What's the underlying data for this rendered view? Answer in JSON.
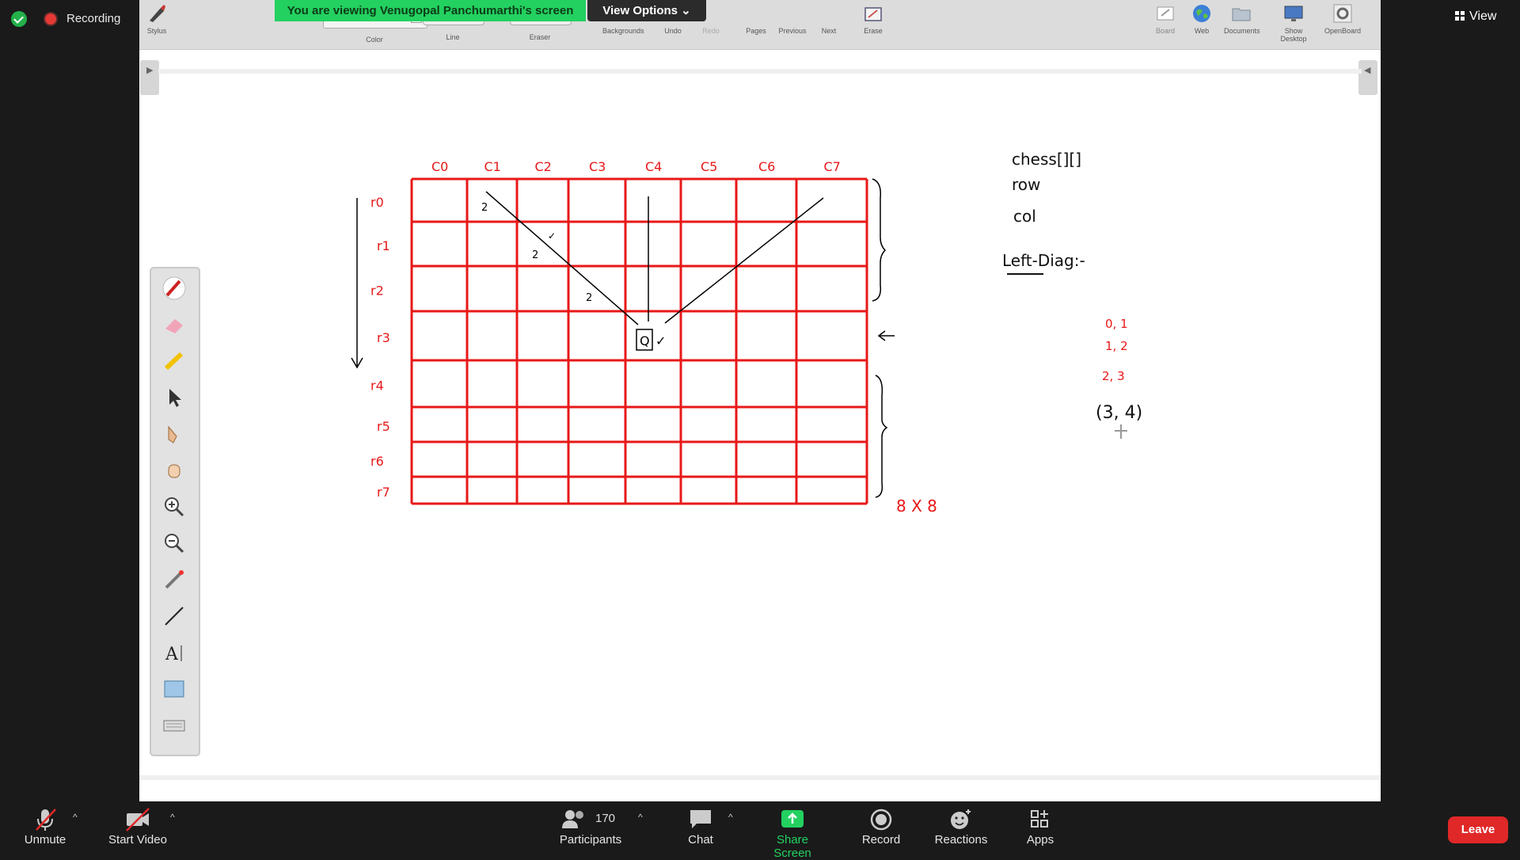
{
  "zoom_top": {
    "recording_label": "Recording",
    "view_label": "View"
  },
  "share_banner": {
    "viewing_text": "You are viewing Venugopal Panchumarthi's screen",
    "view_options_label": "View Options"
  },
  "openboard_toolbar": {
    "items": [
      {
        "label": "Stylus",
        "icon": "stylus-icon"
      },
      {
        "label": "Color",
        "icon": "color-swatches"
      },
      {
        "label": "Line",
        "icon": "line-width-icon"
      },
      {
        "label": "Eraser",
        "icon": "eraser-width-icon"
      },
      {
        "label": "Backgrounds",
        "icon": "background-icon"
      },
      {
        "label": "Undo",
        "icon": "undo-icon"
      },
      {
        "label": "Redo",
        "icon": "redo-icon"
      },
      {
        "label": "Pages",
        "icon": "pages-icon"
      },
      {
        "label": "Previous",
        "icon": "previous-icon"
      },
      {
        "label": "Next",
        "icon": "next-icon"
      },
      {
        "label": "Erase",
        "icon": "erase-all-icon"
      }
    ],
    "right_items": [
      {
        "label": "Board",
        "icon": "board-icon"
      },
      {
        "label": "Web",
        "icon": "globe-icon"
      },
      {
        "label": "Documents",
        "icon": "folder-icon"
      },
      {
        "label": "Show Desktop",
        "icon": "desktop-icon"
      },
      {
        "label": "OpenBoard",
        "icon": "gear-icon"
      }
    ],
    "colors": [
      "#000000",
      "#e00000",
      "#1a4fa0",
      "#1a8a1a",
      "#ffffff"
    ]
  },
  "palette_tools": [
    "pen-tool",
    "eraser-tool",
    "highlighter-tool",
    "selector-tool",
    "interact-tool",
    "hand-tool",
    "zoom-in-tool",
    "zoom-out-tool",
    "laser-pointer-tool",
    "line-tool",
    "text-tool",
    "capture-tool",
    "keyboard-tool"
  ],
  "whiteboard": {
    "column_labels": [
      "C0",
      "C1",
      "C2",
      "C3",
      "C4",
      "C5",
      "C6",
      "C7"
    ],
    "row_labels": [
      "r0",
      "r1",
      "r2",
      "r3",
      "r4",
      "r5",
      "r6",
      "r7"
    ],
    "board_size_label": "8 X 8",
    "queen_label": "Q",
    "notes": [
      "chess[][]",
      "row",
      "col"
    ],
    "left_diag_heading": "Left-Diag:-",
    "pairs": [
      "0, 1",
      "1, 2",
      "2, 3"
    ],
    "highlight_pair": "(3, 4)",
    "check_marks": [
      "2",
      "2",
      "2"
    ]
  },
  "zoom_bottom": {
    "unmute_label": "Unmute",
    "start_video_label": "Start Video",
    "participants_label": "Participants",
    "participants_count": "170",
    "chat_label": "Chat",
    "share_screen_label": "Share Screen",
    "record_label": "Record",
    "reactions_label": "Reactions",
    "apps_label": "Apps",
    "leave_label": "Leave"
  },
  "colors": {
    "share_green": "#23d160",
    "grid_red": "#e81818",
    "leave_red": "#e02828"
  }
}
